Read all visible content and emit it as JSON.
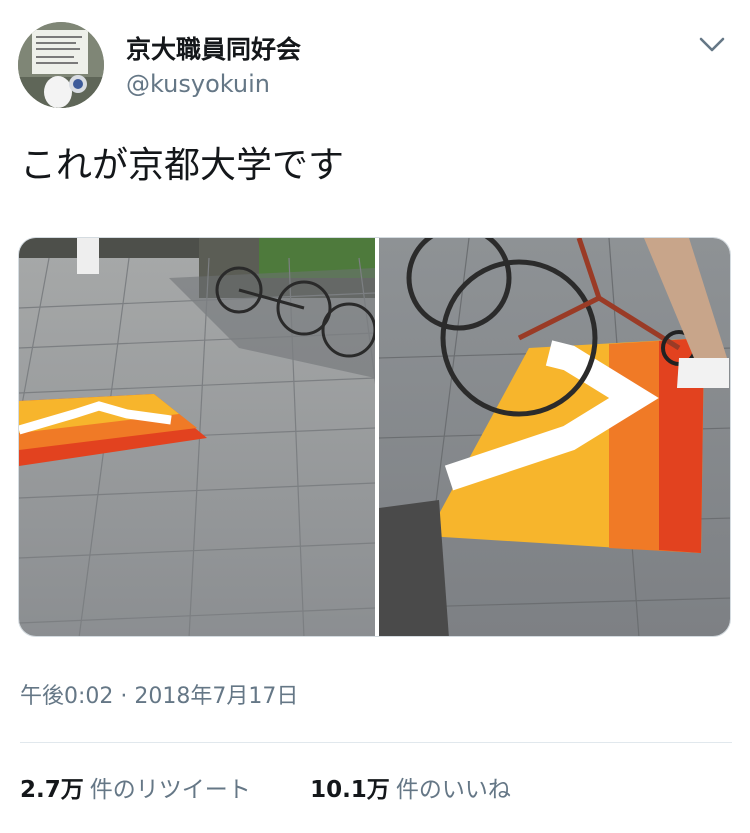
{
  "header": {
    "display_name": "京大職員同好会",
    "handle": "@kusyokuin"
  },
  "tweet": {
    "text": "これが京都大学です",
    "timestamp": "午後0:02 · 2018年7月17日"
  },
  "stats": {
    "retweets_count": "2.7万",
    "retweets_label": "件のリツイート",
    "likes_count": "10.1万",
    "likes_label": "件のいいね"
  },
  "icons": {
    "menu": "chevron-down-icon"
  },
  "colors": {
    "text_primary": "#14171a",
    "text_secondary": "#657786",
    "divider": "#e1e8ed",
    "mat_yellow": "#f7b52c",
    "mat_orange": "#f07a26",
    "mat_red": "#e2421f",
    "pavement": "#8f9396"
  }
}
